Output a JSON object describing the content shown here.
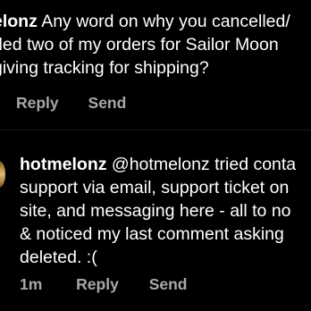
{
  "top_comment": {
    "username": "elonz",
    "lines": [
      "Any word on why you cancelled/",
      "ded two of my orders for Sailor Moon",
      "giving tracking for shipping?"
    ],
    "actions": {
      "reply_label": "Reply",
      "send_label": "Send"
    }
  },
  "reply_comment": {
    "username": "hotmelonz",
    "lines": [
      "@hotmelonz tried conta",
      "support via email, support ticket on",
      "site, and messaging here - all to no",
      "& noticed my last comment asking",
      "deleted. :("
    ],
    "actions": {
      "time": "1m",
      "reply_label": "Reply",
      "send_label": "Send"
    }
  },
  "colors": {
    "background": "#000000",
    "text": "#ffffff",
    "muted": "#a8a8a8"
  }
}
